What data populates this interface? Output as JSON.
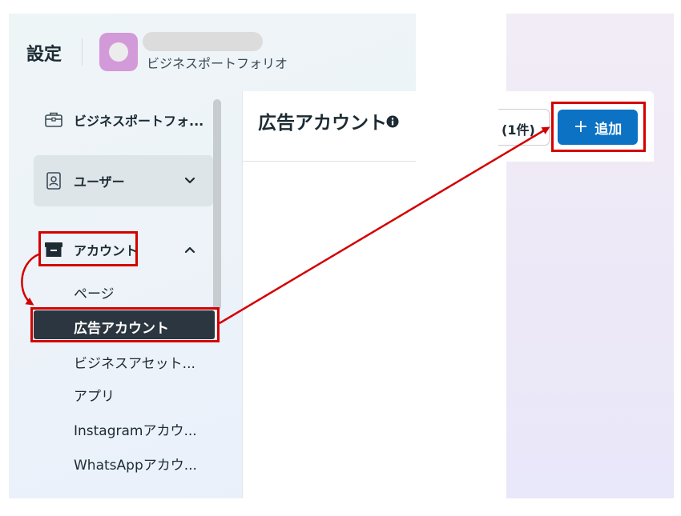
{
  "header": {
    "title": "設定",
    "portfolio_label": "ビジネスポートフォリオ"
  },
  "sidebar": {
    "items": [
      {
        "label": "ビジネスポートフォ...",
        "icon": "briefcase-icon"
      },
      {
        "label": "ユーザー",
        "icon": "id-badge-icon",
        "expanded": false
      },
      {
        "label": "アカウント",
        "icon": "archive-box-icon",
        "expanded": true
      }
    ],
    "sub_items": {
      "pages": "ページ",
      "ad_accounts": "広告アカウント",
      "business_assets": "ビジネスアセット...",
      "apps": "アプリ",
      "instagram": "Instagramアカウ...",
      "whatsapp": "WhatsAppアカウ..."
    }
  },
  "main": {
    "title": "広告アカウント",
    "count_label": "(1件)",
    "add_button_label": "追加",
    "add_button_icon": "plus-icon"
  },
  "colors": {
    "accent": "#0b72c4",
    "active_item": "#2b3640",
    "annotation": "#d40000",
    "avatar": "#d39ad9"
  }
}
